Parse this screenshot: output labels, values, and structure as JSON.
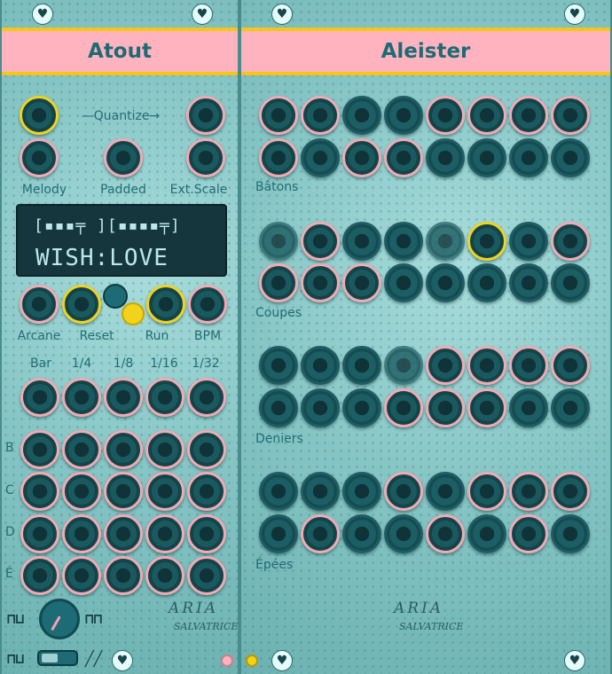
{
  "left_panel": {
    "title": "Atout",
    "quantize_label": "—Quantize→",
    "top_labels": [
      "Melody",
      "Padded",
      "Ext.Scale"
    ],
    "display": {
      "pattern": "[▪▪▪╤ ][▪▪▪▪╤]",
      "text": "WISH:LOVE"
    },
    "control_labels": [
      "Arcane",
      "Reset",
      "Run",
      "BPM"
    ],
    "division_labels": [
      "Bar",
      "1/4",
      "1/8",
      "1/16",
      "1/32"
    ],
    "row_labels": [
      "B",
      "C",
      "D",
      "É"
    ],
    "signature": [
      "ARIA",
      "SALVATRICE"
    ]
  },
  "right_panel": {
    "title": "Aleister",
    "group_labels": [
      "Bâtons",
      "Coupes",
      "Deniers",
      "Épées"
    ],
    "signature": [
      "ARIA",
      "SALVATRICE"
    ]
  },
  "colors": {
    "panel": "#88c6c6",
    "header": "#ffb3bf",
    "accent_yellow": "#f5c518",
    "text": "#236d74",
    "jack_pink": "#f1aab4",
    "jack_dark": "#1f5c63"
  },
  "icons": [
    "heart-screw-icon",
    "square-wave-icon",
    "saw-wave-icon",
    "pointer-arrow-icon"
  ]
}
